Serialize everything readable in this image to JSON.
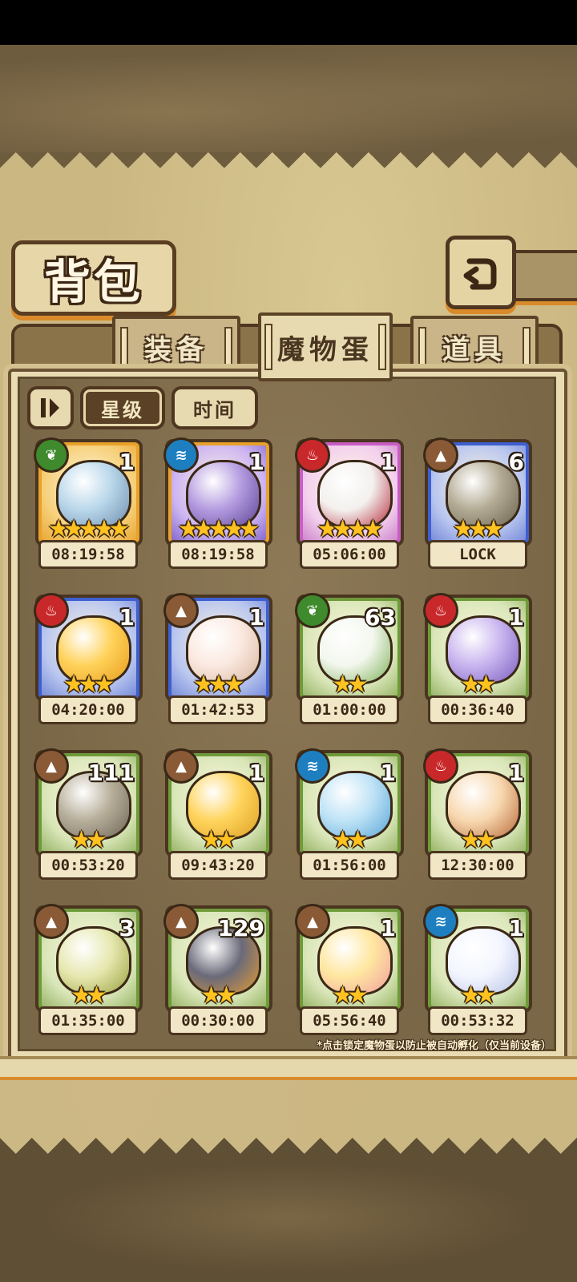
{
  "header": {
    "title": "背包"
  },
  "tabs": [
    {
      "label": "装备"
    },
    {
      "label": "魔物蛋"
    },
    {
      "label": "道具"
    }
  ],
  "sort": {
    "star_label": "星级",
    "time_label": "时间"
  },
  "hint": "*点击锁定魔物蛋以防止被自动孵化（仅当前设备）",
  "items": [
    {
      "element": "grass",
      "count": "1",
      "stars": 5,
      "timer": "08:19:58"
    },
    {
      "element": "water",
      "count": "1",
      "stars": 5,
      "timer": "08:19:58"
    },
    {
      "element": "fire",
      "count": "1",
      "stars": 4,
      "timer": "05:06:00"
    },
    {
      "element": "earth",
      "count": "6",
      "stars": 3,
      "timer": "LOCK"
    },
    {
      "element": "fire",
      "count": "1",
      "stars": 3,
      "timer": "04:20:00"
    },
    {
      "element": "earth",
      "count": "1",
      "stars": 3,
      "timer": "01:42:53"
    },
    {
      "element": "grass",
      "count": "63",
      "stars": 2,
      "timer": "01:00:00"
    },
    {
      "element": "fire",
      "count": "1",
      "stars": 2,
      "timer": "00:36:40"
    },
    {
      "element": "earth",
      "count": "111",
      "stars": 2,
      "timer": "00:53:20"
    },
    {
      "element": "earth",
      "count": "1",
      "stars": 2,
      "timer": "09:43:20"
    },
    {
      "element": "water",
      "count": "1",
      "stars": 2,
      "timer": "01:56:00"
    },
    {
      "element": "fire",
      "count": "1",
      "stars": 2,
      "timer": "12:30:00"
    },
    {
      "element": "earth",
      "count": "3",
      "stars": 2,
      "timer": "01:35:00"
    },
    {
      "element": "earth",
      "count": "129",
      "stars": 2,
      "timer": "00:30:00"
    },
    {
      "element": "earth",
      "count": "1",
      "stars": 2,
      "timer": "05:56:40"
    },
    {
      "element": "water",
      "count": "1",
      "stars": 2,
      "timer": "00:53:32"
    }
  ],
  "colors": {
    "frame_gold": "#e8a12a",
    "frame_purple": "#c85ec4",
    "frame_blue": "#3e5fcf",
    "frame_green": "#6f9a3a",
    "element_grass": "#3e8a2c",
    "element_water": "#1e7fc0",
    "element_fire": "#c9282a",
    "element_earth": "#8a5a36"
  }
}
